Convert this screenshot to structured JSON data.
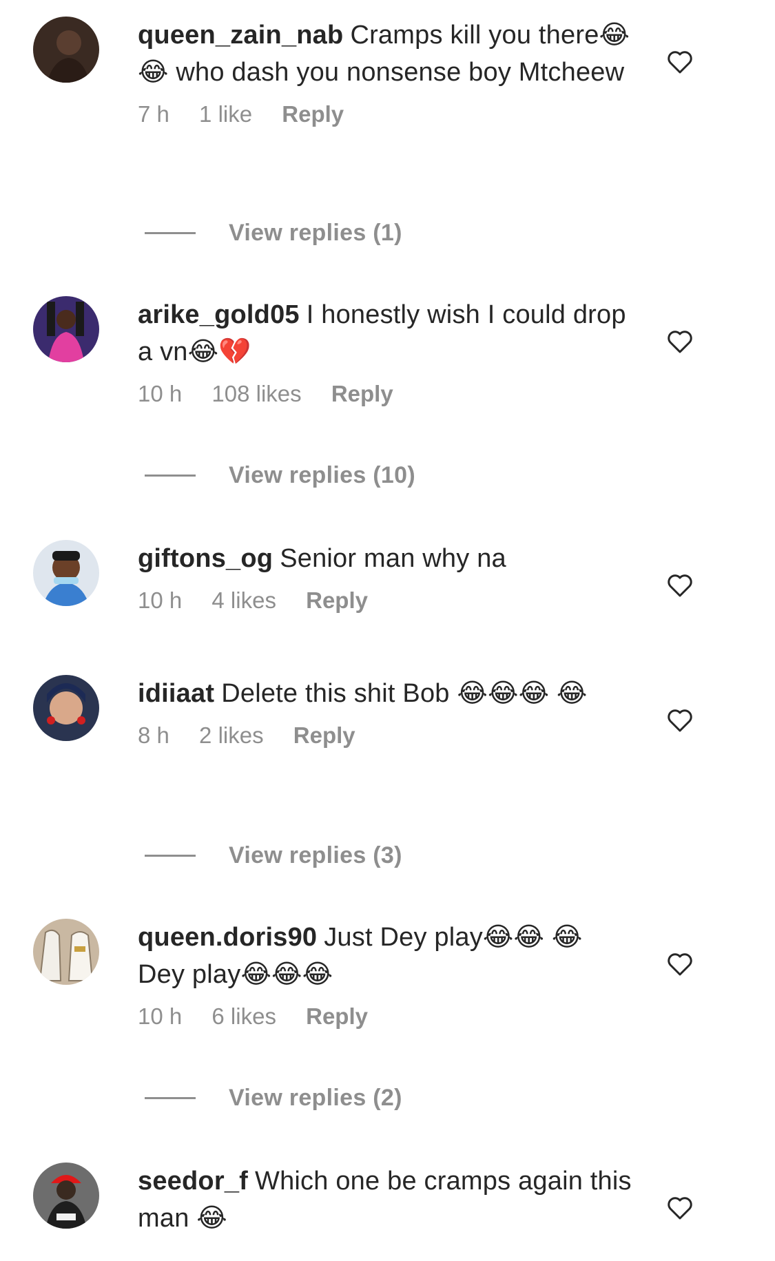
{
  "comments": [
    {
      "username": "queen_zain_nab",
      "text": "Cramps kill you there😂 😂 who dash you nonsense boy Mtcheew",
      "time": "7 h",
      "likes": "1 like",
      "reply": "Reply",
      "view_replies": "View replies (1)",
      "avatar_icon": "profile-photo-dark"
    },
    {
      "username": "arike_gold05",
      "text": "I honestly wish I could drop a vn😂💔",
      "time": "10 h",
      "likes": "108 likes",
      "reply": "Reply",
      "view_replies": "View replies (10)",
      "avatar_icon": "profile-photo-pink"
    },
    {
      "username": "giftons_og",
      "text": "Senior man why na",
      "time": "10 h",
      "likes": "4 likes",
      "reply": "Reply",
      "avatar_icon": "profile-photo-blue"
    },
    {
      "username": "idiiaat",
      "text": "Delete this shit Bob 😂😂😂 😂",
      "time": "8 h",
      "likes": "2 likes",
      "reply": "Reply",
      "view_replies": "View replies (3)",
      "avatar_icon": "profile-photo-woman"
    },
    {
      "username": "queen.doris90",
      "text": "Just Dey play😂😂 😂 Dey play😂😂😂",
      "time": "10 h",
      "likes": "6 likes",
      "reply": "Reply",
      "view_replies": "View replies (2)",
      "avatar_icon": "profile-photo-shoes"
    },
    {
      "username": "seedor_f",
      "text": "Which one be cramps again this man 😂",
      "avatar_icon": "profile-photo-red-cap"
    }
  ],
  "icons": {
    "like": "heart-outline-icon"
  },
  "colors": {
    "primary_text": "#262626",
    "secondary_text": "#8e8e8e",
    "background": "#ffffff"
  }
}
